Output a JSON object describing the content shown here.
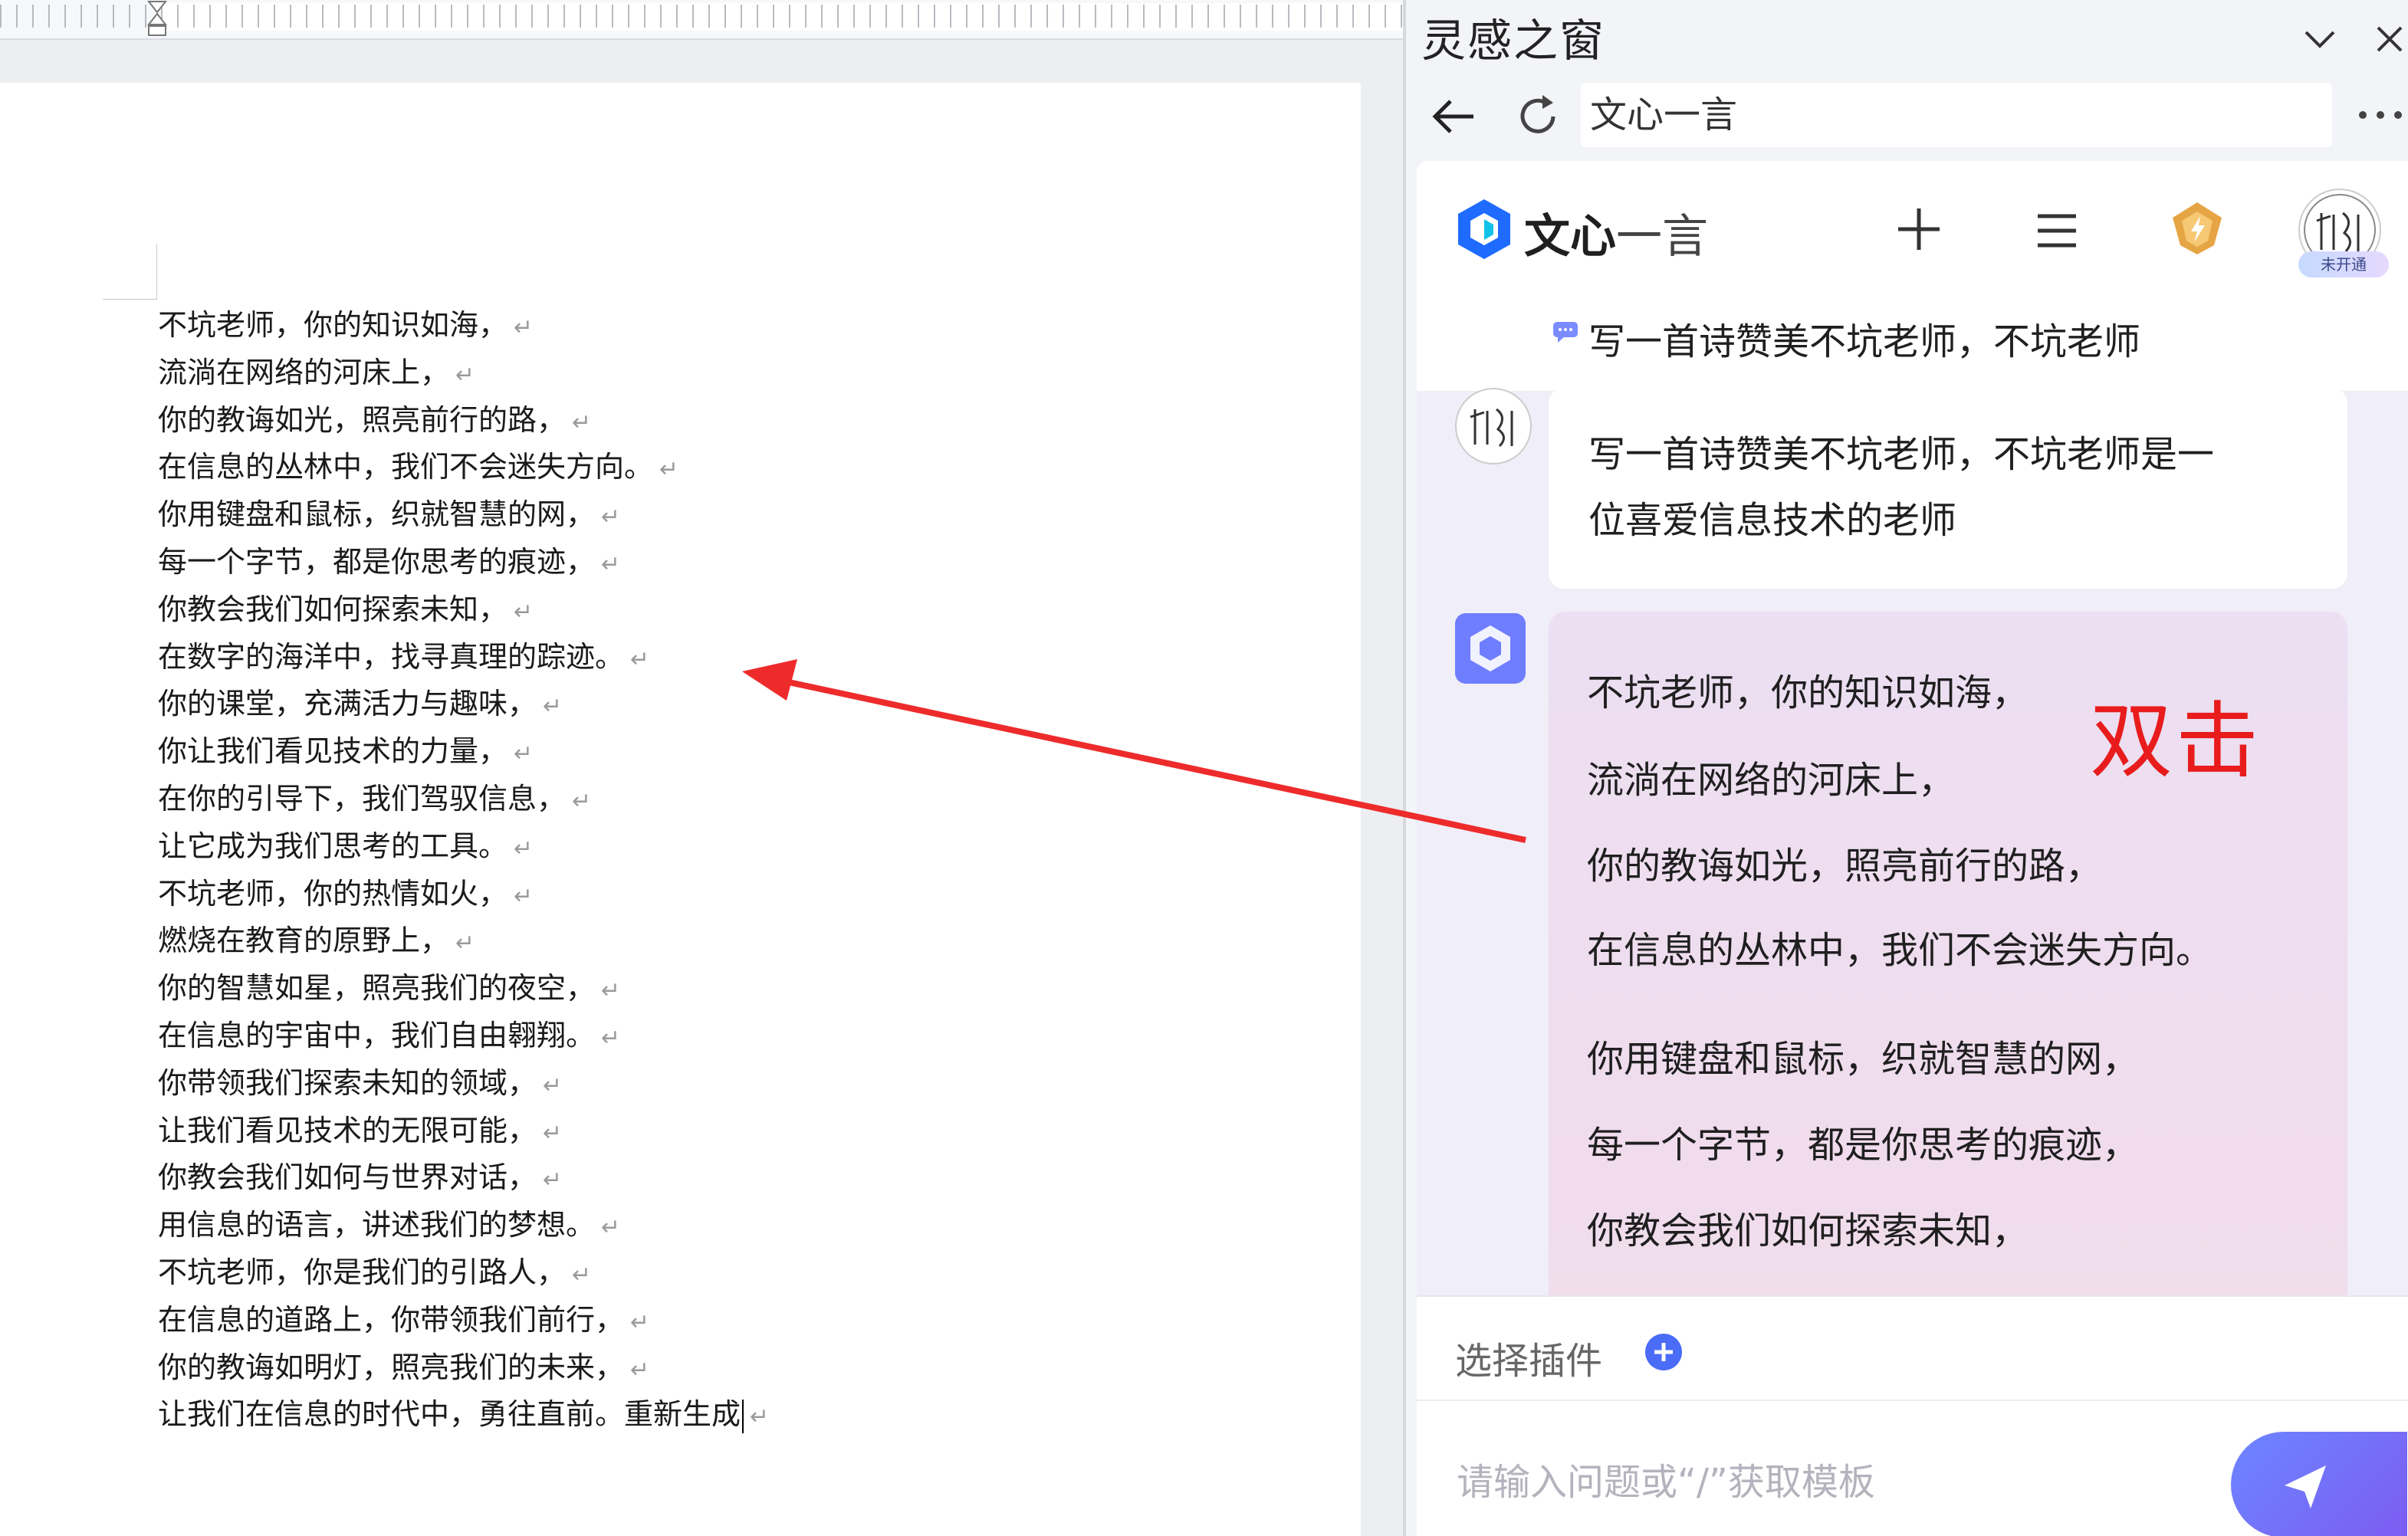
{
  "document": {
    "lines": [
      "不坑老师，你的知识如海，",
      "流淌在网络的河床上，",
      "你的教诲如光，照亮前行的路，",
      "在信息的丛林中，我们不会迷失方向。",
      "你用键盘和鼠标，织就智慧的网，",
      "每一个字节，都是你思考的痕迹，",
      "你教会我们如何探索未知，",
      "在数字的海洋中，找寻真理的踪迹。",
      "你的课堂，充满活力与趣味，",
      "你让我们看见技术的力量，",
      "在你的引导下，我们驾驭信息，",
      "让它成为我们思考的工具。",
      "不坑老师，你的热情如火，",
      "燃烧在教育的原野上，",
      "你的智慧如星，照亮我们的夜空，",
      "在信息的宇宙中，我们自由翱翔。",
      "你带领我们探索未知的领域，",
      "让我们看见技术的无限可能，",
      "你教会我们如何与世界对话，",
      "用信息的语言，讲述我们的梦想。",
      "不坑老师，你是我们的引路人，",
      "在信息的道路上，你带领我们前行，",
      "你的教诲如明灯，照亮我们的未来，",
      "让我们在信息的时代中，勇往直前。重新生成"
    ],
    "paragraph_mark": "↵"
  },
  "panel": {
    "title": "灵感之窗",
    "address": "文心一言"
  },
  "chat": {
    "brand_bold": "文心",
    "brand_light": "一言",
    "avatar_badge": "未开通",
    "preview_text": "写一首诗赞美不坑老师，不坑老师",
    "user_message_line1": "写一首诗赞美不坑老师，不坑老师是一",
    "user_message_line2": "位喜爱信息技术的老师",
    "ai_lines": [
      "不坑老师，你的知识如海，",
      "流淌在网络的河床上，",
      "你的教诲如光，照亮前行的路，",
      "在信息的丛林中，我们不会迷失方向。",
      "你用键盘和鼠标，织就智慧的网，",
      "每一个字节，都是你思考的痕迹，",
      "你教会我们如何探索未知，"
    ],
    "plugin_label": "选择插件",
    "input_placeholder": "请输入问题或“/”获取模板"
  },
  "annotation": {
    "text": "双击",
    "color": "#e81c1c"
  },
  "colors": {
    "accent": "#6c86ff",
    "annotation": "#e81c1c"
  }
}
